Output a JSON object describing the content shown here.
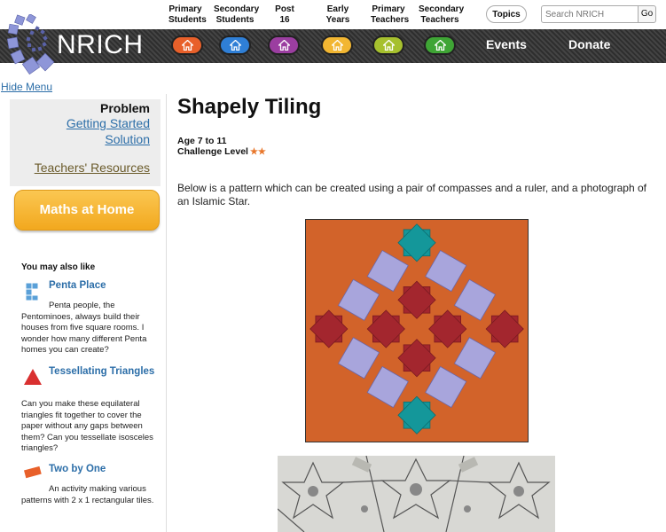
{
  "nav": {
    "items": [
      {
        "line1": "Primary",
        "line2": "Students"
      },
      {
        "line1": "Secondary",
        "line2": "Students"
      },
      {
        "line1": "Post 16",
        "line2": ""
      },
      {
        "line1": "Early Years",
        "line2": ""
      },
      {
        "line1": "Primary",
        "line2": "Teachers"
      },
      {
        "line1": "Secondary",
        "line2": "Teachers"
      }
    ],
    "topics": "Topics",
    "search_placeholder": "Search NRICH",
    "go": "Go"
  },
  "banner": {
    "logo": "NRICH",
    "pill_colors": [
      "#e8602a",
      "#2f7fd6",
      "#9b3ea0",
      "#f2b632",
      "#a6c02e",
      "#3fa535"
    ],
    "events": "Events",
    "donate": "Donate"
  },
  "hide_menu": "Hide Menu",
  "sidebar": {
    "problem": "Problem",
    "getting_started": "Getting Started",
    "solution": "Solution",
    "teachers": "Teachers' Resources",
    "maths_home": "Maths at Home",
    "also_like": "You may also like",
    "related": [
      {
        "title": "Penta Place",
        "desc": "Penta people, the Pentominoes, always build their houses from five square rooms. I wonder how many different Penta homes you can create?",
        "icon": "penta-icon"
      },
      {
        "title": "Tessellating Triangles",
        "desc": "Can you make these equilateral triangles fit together to cover the paper without any gaps between them? Can you tessellate isosceles triangles?",
        "icon": "triangle-icon"
      },
      {
        "title": "Two by One",
        "desc": "An activity making various patterns with 2 x 1 rectangular tiles.",
        "icon": "rectangle-icon"
      }
    ]
  },
  "main": {
    "title": "Shapely Tiling",
    "age": "Age 7 to 11",
    "challenge": "Challenge Level",
    "stars": "★★",
    "intro": "Below is a pattern which can be created using a pair of compasses and a ruler, and a photograph of an Islamic Star."
  },
  "colors": {
    "link": "#2c6ea8",
    "tile_bg": "#d2632a",
    "star_red": "#a3262e",
    "star_teal": "#14979a",
    "square_lilac": "#a8a5dc",
    "maths_home": "#f2a81e"
  }
}
